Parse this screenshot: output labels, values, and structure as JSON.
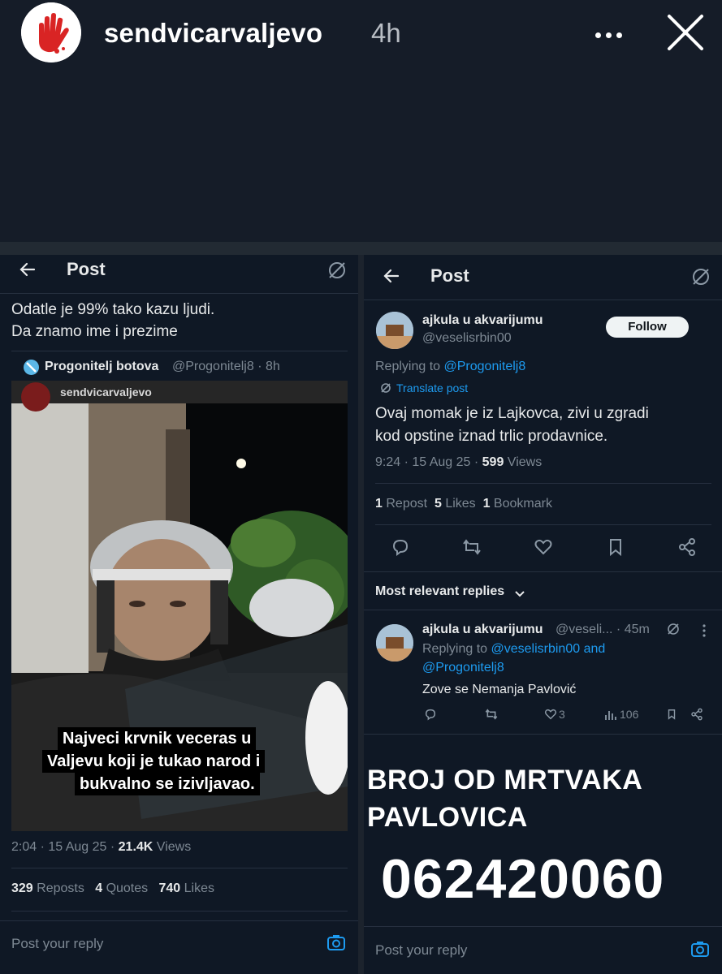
{
  "story": {
    "username": "sendvicarvaljevo",
    "time": "4h"
  },
  "left_post": {
    "header_title": "Post",
    "text_line1": "Odatle je 99% tako kazu ljudi.",
    "text_line2": "Da znamo ime i prezime",
    "quoted_name": "Progonitelj botova",
    "quoted_handle": "@Progonitelj8 · 8h",
    "cropped_header_text": "sendvicarvaljevo",
    "caption_line1": "Najveci krvnik veceras u",
    "caption_line2": "Valjevu koji je tukao narod i",
    "caption_line3": "bukvalno se izivljavao.",
    "meta_time": "2:04 · 15 Aug 25 · ",
    "meta_views_count": "21.4K",
    "meta_views_label": " Views",
    "reposts_count": "329",
    "reposts_label": "Reposts",
    "quotes_count": "4",
    "quotes_label": "Quotes",
    "likes_count": "740",
    "likes_label": "Likes",
    "reply_placeholder": "Post your reply"
  },
  "right_post": {
    "header_title": "Post",
    "author_name": "ajkula u akvarijumu",
    "author_handle": "@veselisrbin00",
    "follow_label": "Follow",
    "replying_prefix": "Replying to ",
    "replying_handle": "@Progonitelj8",
    "translate_label": "Translate post",
    "text_line1": "Ovaj momak je iz Lajkovca, zivi u zgradi",
    "text_line2": "kod opstine iznad trlic prodavnice.",
    "meta_time": "9:24 · 15 Aug 25 · ",
    "meta_views_count": "599",
    "meta_views_label": " Views",
    "repost_count": "1",
    "repost_label": "Repost",
    "likes_count": "5",
    "likes_label": "Likes",
    "bookmark_count": "1",
    "bookmark_label": "Bookmark",
    "sort_label": "Most relevant replies",
    "reply": {
      "author_name": "ajkula u akvarijumu",
      "author_handle": "@veseli... · 45m",
      "replying_prefix": "Replying to ",
      "replying_handle1": "@veselisrbin00",
      "replying_and": " and",
      "replying_handle2": "@Progonitelj8",
      "text": "Zove se Nemanja Pavlović",
      "likes": "3",
      "views": "106"
    },
    "overlay_line1": "BROJ OD MRTVAKA",
    "overlay_line2": "PAVLOVICA",
    "overlay_number": "062420060",
    "reply_placeholder": "Post your reply"
  },
  "colors": {
    "background": "#151c28",
    "panel": "#0f1825",
    "accent": "#1d9bf0",
    "muted": "#7d8893",
    "logo_red": "#d92424"
  }
}
